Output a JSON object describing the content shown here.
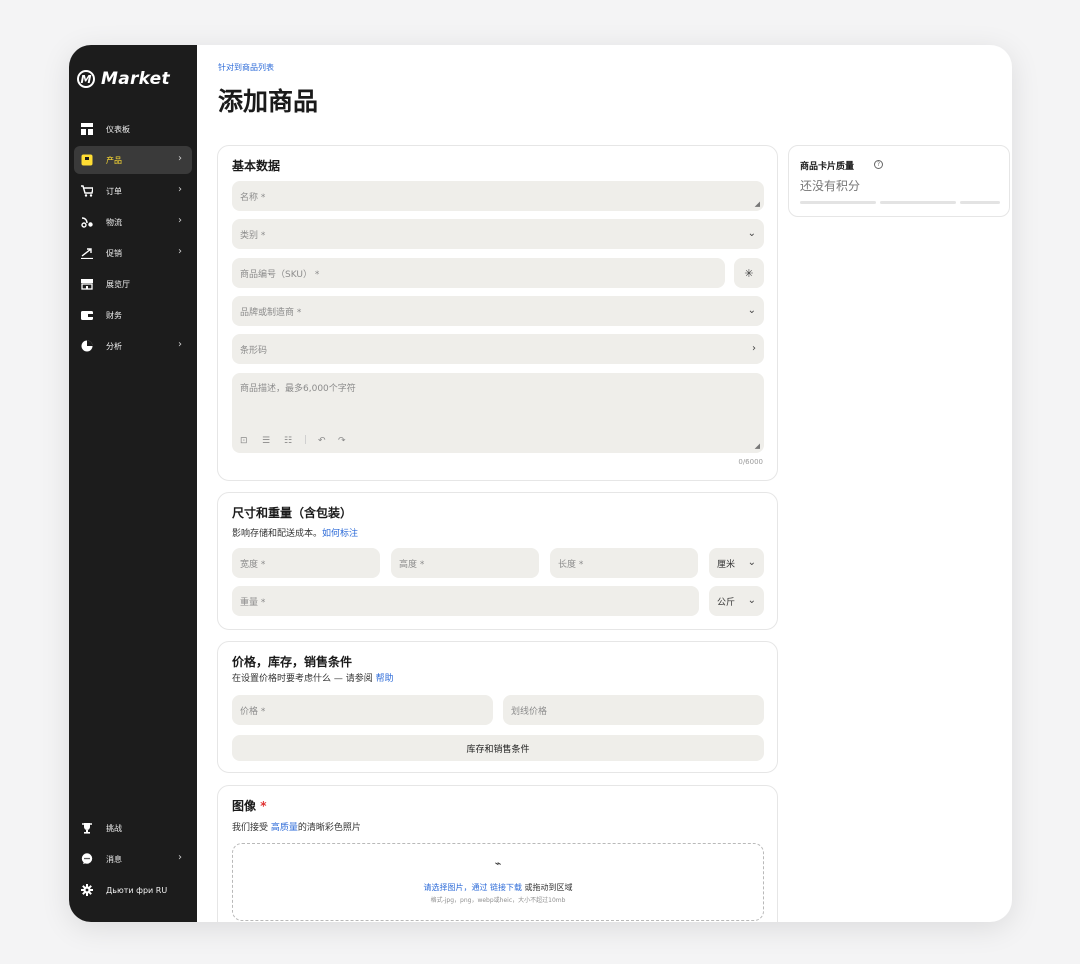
{
  "sidebar": {
    "logo_mark": "M",
    "logo_text": "Market",
    "items": [
      {
        "label": "仪表板",
        "icon": "dashboard-icon",
        "chevron": ""
      },
      {
        "label": "产品",
        "icon": "box-icon",
        "chevron": "›"
      },
      {
        "label": "订单",
        "icon": "cart-icon",
        "chevron": "›"
      },
      {
        "label": "物流",
        "icon": "truck-icon",
        "chevron": "›"
      },
      {
        "label": "促销",
        "icon": "trend-icon",
        "chevron": "›"
      },
      {
        "label": "展览厅",
        "icon": "store-icon",
        "chevron": ""
      },
      {
        "label": "财务",
        "icon": "wallet-icon",
        "chevron": ""
      },
      {
        "label": "分析",
        "icon": "pie-chart-icon",
        "chevron": "›"
      }
    ],
    "bottom_items": [
      {
        "label": "挑战",
        "icon": "trophy-icon",
        "chevron": ""
      },
      {
        "label": "消息",
        "icon": "chat-icon",
        "chevron": "›"
      },
      {
        "label": "Дьюти фри RU",
        "icon": "gear-icon",
        "chevron": ""
      }
    ],
    "active_item": "产品",
    "accent": "#ffdd33"
  },
  "header": {
    "breadcrumb": "针对到商品列表",
    "title": "添加商品"
  },
  "basic": {
    "title": "基本数据",
    "name_placeholder": "名称 *",
    "category_placeholder": "类别 *",
    "sku_placeholder": "商品编号（SKU） *",
    "brand_placeholder": "品牌或制造商 *",
    "barcode_placeholder": "条形码",
    "description_placeholder": "商品描述，最多6,000个字符",
    "counter": "0/6000"
  },
  "dimensions": {
    "title": "尺寸和重量（含包装）",
    "subtitle": "影响存储和配送成本。",
    "subtitle_link": "如何标注",
    "width_placeholder": "宽度 *",
    "height_placeholder": "高度 *",
    "length_placeholder": "长度 *",
    "length_unit": "厘米",
    "weight_placeholder": "重量 *",
    "weight_unit": "公斤"
  },
  "price": {
    "title": "价格，库存，销售条件",
    "subtitle": "在设置价格时要考虑什么 — 请参阅",
    "subtitle_link": "帮助",
    "price_placeholder": "价格 *",
    "strike_placeholder": "划线价格",
    "stock_button": "库存和销售条件"
  },
  "images": {
    "title": "图像",
    "required_mark": "*",
    "subtitle_pre": "我们接受",
    "subtitle_link": "高质量",
    "subtitle_post": "的清晰彩色照片",
    "drop_link1": "请选择图片，通过",
    "drop_link2": "链接下载",
    "drop_text": "或拖动到区域",
    "drop_hint": "格式-jpg，png，webp或heic，大小不超过10mb"
  },
  "quality_panel": {
    "title": "商品卡片质量",
    "value": "还没有积分"
  },
  "colors": {
    "link": "#2d6bd8",
    "sidebar_bg": "#1c1c1c",
    "field_bg": "#efeeea",
    "required": "#e03131"
  }
}
